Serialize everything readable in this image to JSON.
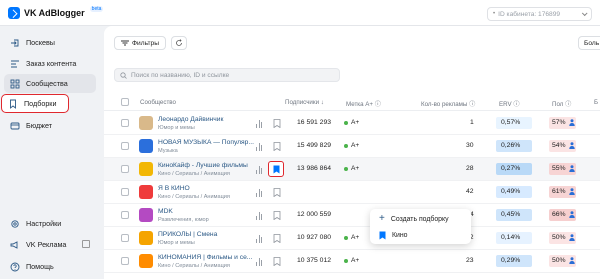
{
  "app": {
    "title": "VK AdBlogger",
    "beta": "beta"
  },
  "cabinet": {
    "placeholder": "ID кабинета: 176899",
    "bullet": "•"
  },
  "sidebar": {
    "items": [
      {
        "label": "Поскевы",
        "icon": "login-icon"
      },
      {
        "label": "Заказ контента",
        "icon": "list-icon"
      },
      {
        "label": "Сообщества",
        "icon": "community-icon"
      },
      {
        "label": "Подборки",
        "icon": "bookmark-icon"
      },
      {
        "label": "Бюджет",
        "icon": "wallet-icon"
      },
      {
        "label": "Настройки",
        "icon": "gear-icon"
      },
      {
        "label": "VK Реклама",
        "icon": "ads-icon"
      },
      {
        "label": "Помощь",
        "icon": "help-icon"
      }
    ]
  },
  "toolbar": {
    "filters_label": "Фильтры",
    "right_label": "Боль"
  },
  "search": {
    "placeholder": "Поиск по названию, ID и ссылке"
  },
  "table": {
    "headers": {
      "community": "Сообщество",
      "subscribers": "Подписчики",
      "mark": "Метка A+",
      "ads_count": "Кол-во рекламы",
      "err": "ERV",
      "gender": "Пол",
      "extra": "Б"
    },
    "rows": [
      {
        "name": "Леонардо Дайвинчик",
        "category": "Юмор и мемы",
        "subscribers": "16 591 293",
        "mark": "A+",
        "ads_count": "1",
        "err": "0,57%",
        "gender": "57%",
        "ava_color": "#d9b98a"
      },
      {
        "name": "НОВАЯ МУЗЫКА — Популяр...",
        "category": "Музыка",
        "subscribers": "15 499 829",
        "mark": "A+",
        "ads_count": "30",
        "err": "0,26%",
        "gender": "54%",
        "ava_color": "#2b6fdc"
      },
      {
        "name": "КиноКайф - Лучшие фильмы",
        "category": "Кино / Сериалы / Анимация",
        "subscribers": "13 986 864",
        "mark": "A+",
        "ads_count": "28",
        "err": "0,27%",
        "gender": "55%",
        "ava_color": "#f2b705"
      },
      {
        "name": "Я В КИНО",
        "category": "Кино / Сериалы / Анимация",
        "subscribers": "",
        "mark": "",
        "ads_count": "42",
        "err": "0,49%",
        "gender": "61%",
        "ava_color": "#ef3b3b"
      },
      {
        "name": "MDK",
        "category": "Развлечения, юмор",
        "subscribers": "12 000 559",
        "mark": "",
        "ads_count": "4",
        "err": "0,45%",
        "gender": "66%",
        "ava_color": "#b44ac2"
      },
      {
        "name": "ПРИКОЛЫ | Смена",
        "category": "Юмор и мемы",
        "subscribers": "10 927 080",
        "mark": "A+",
        "ads_count": "62",
        "err": "0,14%",
        "gender": "50%",
        "ava_color": "#f5a400"
      },
      {
        "name": "КИНОМАНИЯ | Фильмы и се...",
        "category": "Кино / Сериалы / Анимация",
        "subscribers": "10 375 012",
        "mark": "A+",
        "ads_count": "23",
        "err": "0,29%",
        "gender": "50%",
        "ava_color": "#ff8c00"
      }
    ]
  },
  "popup": {
    "create_label": "Создать подборку",
    "item_label": "Кино"
  },
  "colors": {
    "accent": "#0077ff",
    "highlight": "#e0282e",
    "mark_dot": "#4bb34b"
  }
}
